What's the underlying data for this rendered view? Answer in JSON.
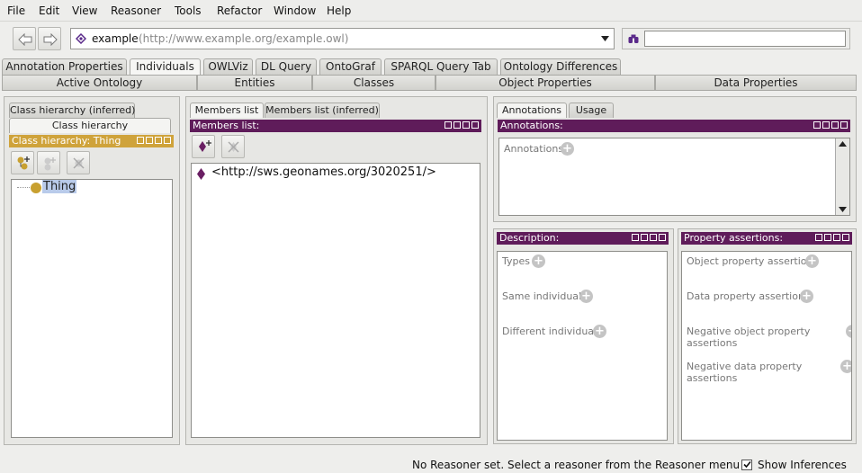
{
  "menubar": {
    "items": [
      "File",
      "Edit",
      "View",
      "Reasoner",
      "Tools",
      "Refactor",
      "Window",
      "Help"
    ]
  },
  "toolbar": {
    "back_icon": "arrow-left-icon",
    "forward_icon": "arrow-right-icon",
    "ontology_name": "example",
    "ontology_iri": "(http://www.example.org/example.owl)",
    "search_icon": "binoculars-icon",
    "search_value": ""
  },
  "tabs": {
    "main": [
      "Annotation Properties",
      "Individuals",
      "OWLViz",
      "DL Query",
      "OntoGraf",
      "SPARQL Query Tab",
      "Ontology Differences"
    ],
    "active": "Individuals",
    "sub": [
      "Active Ontology",
      "Entities",
      "Classes",
      "Object Properties",
      "Data Properties"
    ]
  },
  "class_panel": {
    "tab_inferred": "Class hierarchy (inferred)",
    "tab_asserted": "Class hierarchy",
    "header": "Class hierarchy: Thing",
    "root": "Thing"
  },
  "members_panel": {
    "tab_members": "Members list",
    "tab_members_inferred": "Members list (inferred)",
    "header": "Members list:",
    "items": [
      "<http://sws.geonames.org/3020251/>"
    ]
  },
  "annotations_panel": {
    "tab_annotations": "Annotations",
    "tab_usage": "Usage",
    "header": "Annotations:",
    "label": "Annotations"
  },
  "description_panel": {
    "header": "Description:",
    "types": "Types",
    "same": "Same individuals",
    "different": "Different individuals"
  },
  "property_panel": {
    "header": "Property assertions:",
    "object": "Object property assertions",
    "data": "Data property assertions",
    "neg_object": "Negative object property assertions",
    "neg_data": "Negative data property assertions"
  },
  "status": {
    "message": "No Reasoner set. Select a reasoner from the Reasoner menu",
    "show_inferences": "Show Inferences",
    "show_inferences_checked": true
  },
  "colors": {
    "header_purple": "#5f1c5a",
    "header_gold": "#cfa33b",
    "thing_dot": "#c8a030",
    "individual_diamond": "#6a1f63",
    "selection": "#b9cbea"
  }
}
